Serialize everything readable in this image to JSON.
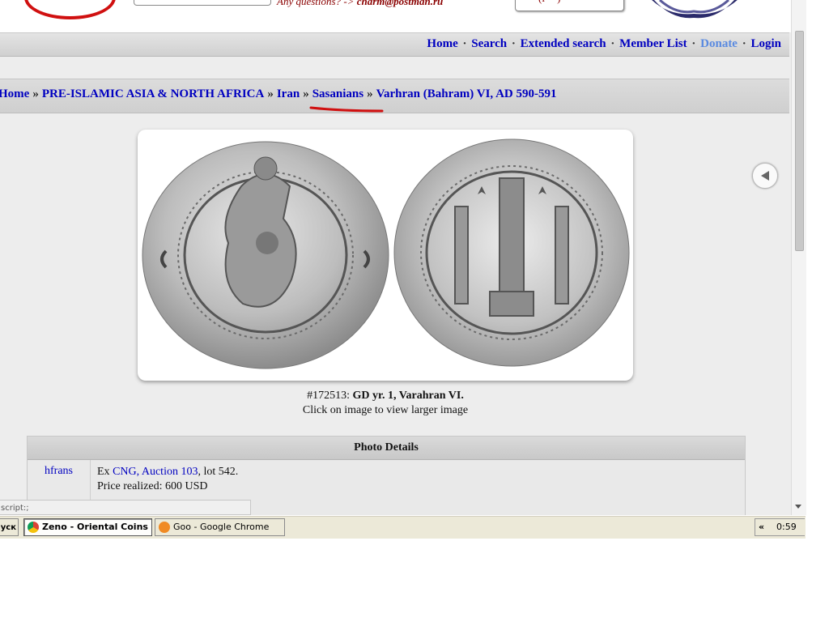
{
  "header": {
    "questions_prefix": "Any questions? -> ",
    "questions_email": "charm@postman.ru"
  },
  "nav": {
    "home": "Home",
    "search": "Search",
    "extended_search": "Extended search",
    "member_list": "Member List",
    "donate": "Donate",
    "login": "Login",
    "separator": "·"
  },
  "breadcrumb": {
    "items": [
      "Home",
      "PRE-ISLAMIC ASIA & NORTH AFRICA",
      "Iran",
      "Sasanians",
      "Varhran (Bahram) VI, AD 590-591"
    ],
    "separator": "»"
  },
  "photo": {
    "id": "#172513:",
    "title": "GD yr. 1, Varahran VI.",
    "hint": "Click on image to view larger image"
  },
  "details": {
    "heading": "Photo Details",
    "user": "hfrans",
    "ex": "Ex ",
    "ex_link": "CNG, Auction 103",
    "lot": ", lot 542.",
    "price": "Price realized: 600 USD"
  },
  "status_text": "script:;",
  "taskbar": {
    "start_label": "уск",
    "task1": "Zeno - Oriental Coins ...",
    "task2": "Goo - Google Chrome",
    "tray_arrow": "«",
    "clock": "0:59"
  },
  "colors": {
    "link": "#0000c0",
    "donate": "#5a8ae0",
    "accent_red": "#d01010"
  }
}
